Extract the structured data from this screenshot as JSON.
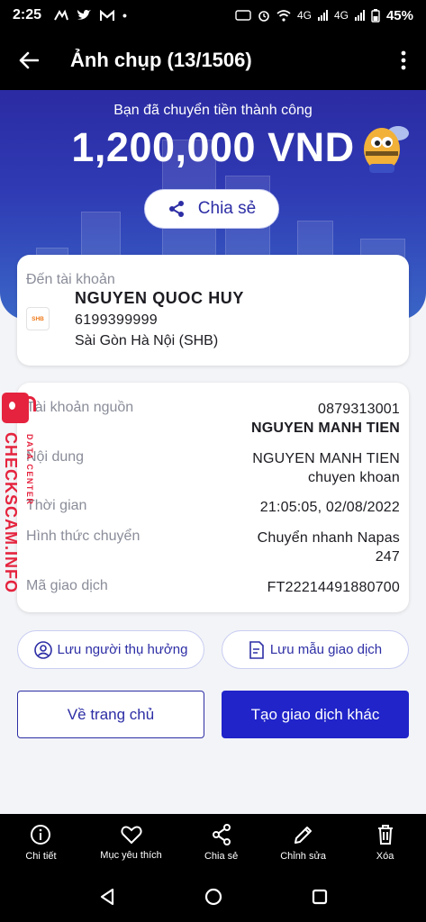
{
  "status_bar": {
    "time": "2:25",
    "network_left": "4G",
    "network_right": "4G",
    "battery": "45%"
  },
  "app_bar": {
    "title": "Ảnh chụp (13/1506)"
  },
  "receipt": {
    "success_message": "Bạn đã chuyển tiền thành công",
    "amount": "1,200,000 VND",
    "share_label": "Chia sẻ",
    "recipient": {
      "label": "Đến tài khoản",
      "bank_logo_text": "SHB",
      "name": "NGUYEN QUOC HUY",
      "account_number": "6199399999",
      "bank_name": "Sài Gòn Hà Nội (SHB)"
    },
    "details": [
      {
        "label": "Tài khoản nguồn",
        "value_line1": "0879313001",
        "value_line2": "NGUYEN MANH TIEN"
      },
      {
        "label": "Nội dung",
        "value_line1": "NGUYEN MANH TIEN",
        "value_line2": "chuyen khoan"
      },
      {
        "label": "Thời gian",
        "value_line1": "21:05:05, 02/08/2022",
        "value_line2": ""
      },
      {
        "label": "Hình thức chuyển",
        "value_line1": "Chuyển nhanh Napas",
        "value_line2": "247"
      },
      {
        "label": "Mã giao dịch",
        "value_line1": "FT22214491880700",
        "value_line2": ""
      }
    ],
    "save_recipient_label": "Lưu người thụ hưởng",
    "save_template_label": "Lưu mẫu giao dịch",
    "home_label": "Về trang chủ",
    "new_transaction_label": "Tạo giao dịch khác",
    "accent_color": "#2024c9"
  },
  "watermark": {
    "main_text": "CHECKSCAM.INFO",
    "sub_text": "DATA CENTER"
  },
  "bottom_actions": [
    {
      "label": "Chi tiết",
      "icon": "info-icon"
    },
    {
      "label": "Mục yêu thích",
      "icon": "heart-icon"
    },
    {
      "label": "Chia sẻ",
      "icon": "share-icon"
    },
    {
      "label": "Chỉnh sửa",
      "icon": "edit-icon"
    },
    {
      "label": "Xóa",
      "icon": "trash-icon"
    }
  ]
}
